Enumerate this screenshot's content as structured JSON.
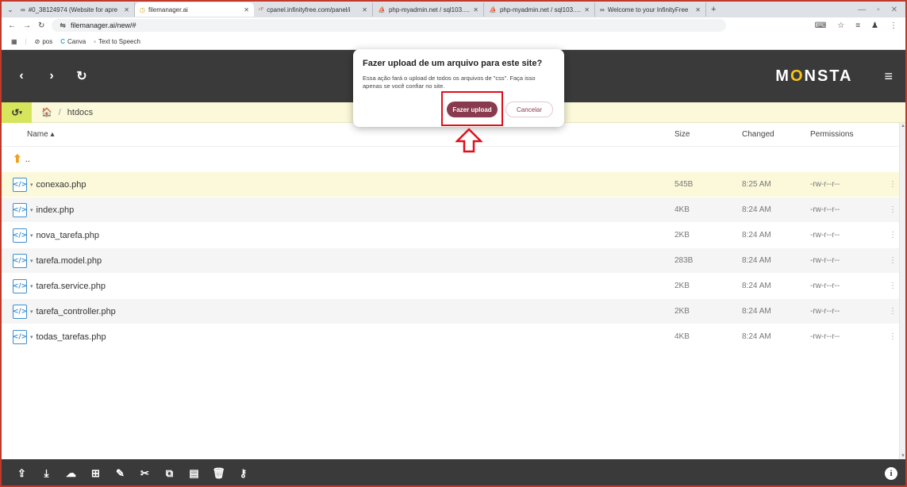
{
  "browser": {
    "tabs": [
      {
        "icon": "∞",
        "title": "#0_38124974 (Website for apre",
        "active": false
      },
      {
        "icon": "◷",
        "title": "filemanager.ai",
        "active": true
      },
      {
        "icon": "ᶜᴾ",
        "title": "cpanel.infinityfree.com/panel/i",
        "active": false
      },
      {
        "icon": "⛵",
        "title": "php-myadmin.net / sql103.bye",
        "active": false
      },
      {
        "icon": "⛵",
        "title": "php-myadmin.net / sql103.infir",
        "active": false
      },
      {
        "icon": "∞",
        "title": "Welcome to your InfinityFree",
        "active": false
      }
    ],
    "url": "filemanager.ai/new/#",
    "bookmarks": [
      {
        "icon": "⊘",
        "label": "pos"
      },
      {
        "icon": "C",
        "label": "Canva"
      },
      {
        "icon": "◦",
        "label": "Text to Speech"
      }
    ]
  },
  "app": {
    "logo_prefix": "M",
    "logo_o": "O",
    "logo_suffix": "NSTA",
    "breadcrumb": {
      "home_icon": "🏠",
      "separator": "/",
      "current": "htdocs"
    },
    "columns": {
      "name": "Name ▴",
      "size": "Size",
      "changed": "Changed",
      "permissions": "Permissions"
    },
    "parent_label": "..",
    "files": [
      {
        "name": "conexao.php",
        "size": "545B",
        "changed": "8:25 AM",
        "permissions": "-rw-r--r--",
        "selected": true
      },
      {
        "name": "index.php",
        "size": "4KB",
        "changed": "8:24 AM",
        "permissions": "-rw-r--r--",
        "selected": false
      },
      {
        "name": "nova_tarefa.php",
        "size": "2KB",
        "changed": "8:24 AM",
        "permissions": "-rw-r--r--",
        "selected": false
      },
      {
        "name": "tarefa.model.php",
        "size": "283B",
        "changed": "8:24 AM",
        "permissions": "-rw-r--r--",
        "selected": false
      },
      {
        "name": "tarefa.service.php",
        "size": "2KB",
        "changed": "8:24 AM",
        "permissions": "-rw-r--r--",
        "selected": false
      },
      {
        "name": "tarefa_controller.php",
        "size": "2KB",
        "changed": "8:24 AM",
        "permissions": "-rw-r--r--",
        "selected": false
      },
      {
        "name": "todas_tarefas.php",
        "size": "4KB",
        "changed": "8:24 AM",
        "permissions": "-rw-r--r--",
        "selected": false
      }
    ],
    "toolbar_icons": [
      "upload-icon",
      "download-icon",
      "cloud-upload-icon",
      "new-folder-icon",
      "edit-icon",
      "cut-icon",
      "copy-icon",
      "paste-icon",
      "delete-icon",
      "rename-icon",
      "info-icon"
    ]
  },
  "dialog": {
    "title": "Fazer upload de um arquivo para este site?",
    "message": "Essa ação fará o upload de todos os arquivos de \"css\". Faça isso apenas se você confiar no site.",
    "confirm_label": "Fazer upload",
    "cancel_label": "Cancelar"
  },
  "colors": {
    "accent": "#8a3a4e",
    "header_bg": "#3a3a3a",
    "breadcrumb_bg": "#fbf9d9",
    "logo_accent": "#f5c518",
    "annotation": "#e0101a"
  }
}
